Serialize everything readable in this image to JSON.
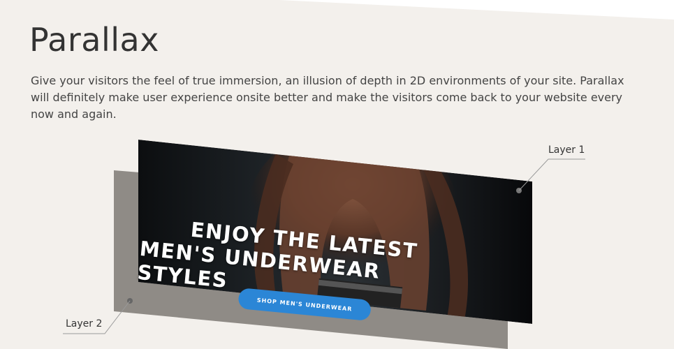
{
  "heading": "Parallax",
  "description": "Give your visitors the feel of true immersion, an illusion of depth in 2D environments of your site. Parallax will definitely make user experience onsite better and make the visitors come back to your website every now and again.",
  "layers": {
    "layer1_label": "Layer 1",
    "layer2_label": "Layer 2"
  },
  "banner": {
    "headline_line1": "ENJOY THE LATEST",
    "headline_line2": "MEN'S UNDERWEAR STYLES",
    "cta_label": "SHOP MEN'S UNDERWEAR"
  },
  "colors": {
    "background": "#f3f0ec",
    "layer2": "#8f8b86",
    "layer1": "#111111",
    "button": "#2b86d6"
  }
}
